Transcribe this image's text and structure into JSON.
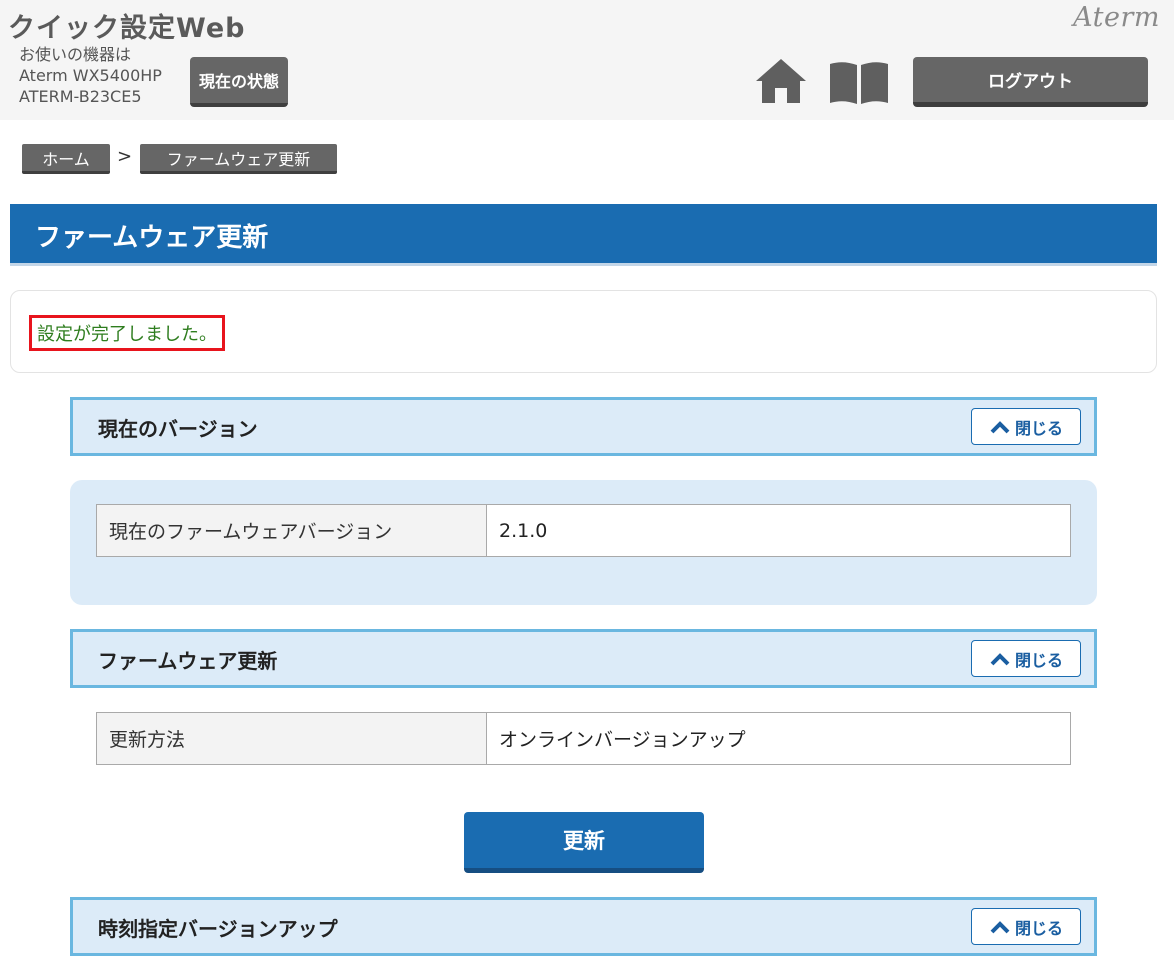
{
  "header": {
    "app_title": "クイック設定Web",
    "device_line1": "お使いの機器は",
    "device_line2": "Aterm WX5400HP",
    "device_line3": "ATERM-B23CE5",
    "status_button": "現在の状態",
    "brand": "Aterm",
    "logout_button": "ログアウト",
    "icons": [
      "home-icon",
      "manual-book-icon"
    ]
  },
  "breadcrumb": {
    "home": "ホーム",
    "separator": ">",
    "current": "ファームウェア更新"
  },
  "page": {
    "title": "ファームウェア更新",
    "message": "設定が完了しました。"
  },
  "sections": {
    "current_version": {
      "title": "現在のバージョン",
      "close_label": "閉じる",
      "rows": [
        {
          "key": "現在のファームウェアバージョン",
          "value": "2.1.0"
        }
      ]
    },
    "firmware_update": {
      "title": "ファームウェア更新",
      "close_label": "閉じる",
      "rows": [
        {
          "key": "更新方法",
          "value": "オンラインバージョンアップ"
        }
      ],
      "update_button": "更新"
    },
    "scheduled_update": {
      "title": "時刻指定バージョンアップ",
      "close_label": "閉じる"
    }
  },
  "colors": {
    "primary_blue": "#1a6cb1",
    "section_bg": "#dcebf8",
    "section_border": "#6ab7e0",
    "button_gray": "#666666",
    "message_green": "#2e7d1e",
    "highlight_red": "#e8141d"
  }
}
